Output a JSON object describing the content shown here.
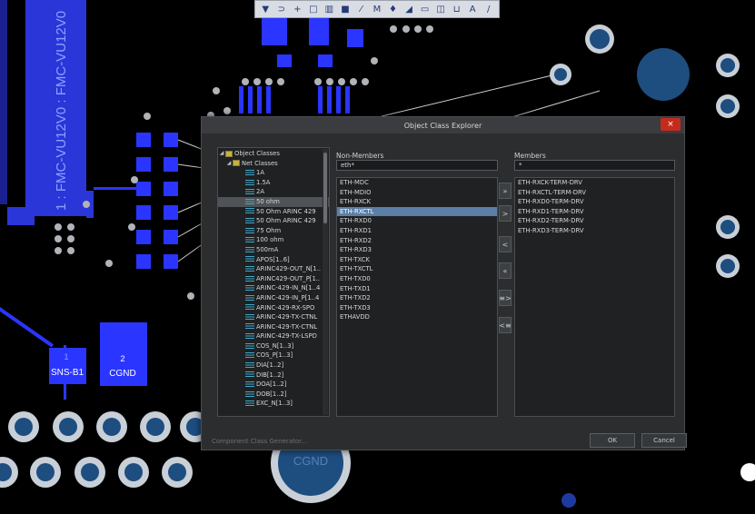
{
  "pcb": {
    "vertical_label": "1 : FMC-VU12V0 : FMC-VU12V0",
    "pad_sns_num": "1",
    "pad_sns_name": "SNS-B1",
    "pad_cgnd_num": "2",
    "pad_cgnd_name": "CGND",
    "bottom_pad_name": "CGND"
  },
  "toolbar": {
    "tools": [
      "filter-icon",
      "route-icon",
      "cross-icon",
      "select-rect-icon",
      "chart-icon",
      "component-icon",
      "line-icon",
      "probe-icon",
      "arc-icon",
      "pin-icon",
      "fill-icon",
      "rect-icon",
      "measure-icon",
      "text-icon",
      "slash-icon"
    ],
    "glyphs": [
      "▼",
      "⊃",
      "+",
      "□",
      "▥",
      "■",
      "⁄",
      "M",
      "♦",
      "◢",
      "▭",
      "◫",
      "⊔",
      "A",
      "/"
    ]
  },
  "dialog": {
    "title": "Object Class Explorer",
    "close_label": "×",
    "non_members_label": "Non-Members",
    "non_members_filter": "eth*",
    "members_label": "Members",
    "members_filter": "*",
    "ok_label": "OK",
    "cancel_label": "Cancel",
    "footer_link": "Component Class Generator...",
    "tree": {
      "root": "Object Classes",
      "group": "Net Classes",
      "items": [
        "1A",
        "1.5A",
        "2A",
        "50 ohm",
        "50 Ohm ARINC 429",
        "50 Ohm ARINC 429",
        "75 Ohm",
        "100 ohm",
        "500mA",
        "APOS[1..6]",
        "ARINC429-OUT_N[1..",
        "ARINC429-OUT_P[1..",
        "ARINC-429-IN_N[1..4",
        "ARINC-429-IN_P[1..4",
        "ARINC-429-RX-SPO",
        "ARINC-429-TX-CTNL",
        "ARINC-429-TX-CTNL",
        "ARINC-429-TX-LSPD",
        "COS_N[1..3]",
        "COS_P[1..3]",
        "DIA[1..2]",
        "DIB[1..2]",
        "DOA[1..2]",
        "DOB[1..2]",
        "EXC_N[1..3]"
      ],
      "selected_index": 3
    },
    "non_members": [
      "ETH-MDC",
      "ETH-MDIO",
      "ETH-RXCK",
      "ETH-RXCTL",
      "ETH-RXD0",
      "ETH-RXD1",
      "ETH-RXD2",
      "ETH-RXD3",
      "ETH-TXCK",
      "ETH-TXCTL",
      "ETH-TXD0",
      "ETH-TXD1",
      "ETH-TXD2",
      "ETH-TXD3",
      "ETHAVDD"
    ],
    "non_members_selected": 3,
    "members": [
      "ETH-RXCK-TERM-DRV",
      "ETH-RXCTL-TERM-DRV",
      "ETH-RXD0-TERM-DRV",
      "ETH-RXD1-TERM-DRV",
      "ETH-RXD2-TERM-DRV",
      "ETH-RXD3-TERM-DRV"
    ],
    "move_buttons": {
      "add_all": "»",
      "add": ">",
      "remove": "<",
      "remove_all": "«",
      "add_matching": "≡>",
      "remove_matching": "<≡"
    }
  }
}
